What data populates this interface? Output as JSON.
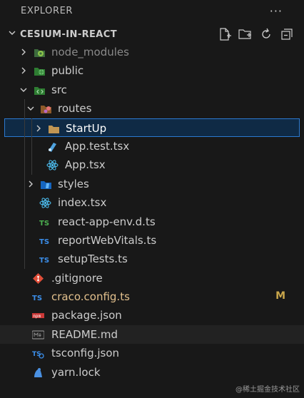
{
  "explorer": {
    "title": "EXPLORER",
    "more": "···"
  },
  "project": {
    "name": "CESIUM-IN-REACT"
  },
  "tree": [
    {
      "label": "node_modules",
      "depth": 0,
      "kind": "folder",
      "expanded": false,
      "icon": "node-modules-folder-icon",
      "color": "#8a8a8a"
    },
    {
      "label": "public",
      "depth": 0,
      "kind": "folder",
      "expanded": false,
      "icon": "public-folder-icon",
      "color": "#cccccc"
    },
    {
      "label": "src",
      "depth": 0,
      "kind": "folder",
      "expanded": true,
      "icon": "src-folder-icon",
      "color": "#cccccc"
    },
    {
      "label": "routes",
      "depth": 1,
      "kind": "folder",
      "expanded": true,
      "icon": "routes-folder-icon",
      "color": "#cccccc"
    },
    {
      "label": "StartUp",
      "depth": 2,
      "kind": "folder",
      "expanded": false,
      "icon": "folder-icon",
      "color": "#ffffff",
      "selected": true
    },
    {
      "label": "App.test.tsx",
      "depth": 2,
      "kind": "file",
      "icon": "test-react-icon",
      "color": "#cccccc"
    },
    {
      "label": "App.tsx",
      "depth": 2,
      "kind": "file",
      "icon": "react-icon",
      "color": "#cccccc"
    },
    {
      "label": "styles",
      "depth": 1,
      "kind": "folder",
      "expanded": false,
      "icon": "styles-folder-icon",
      "color": "#cccccc"
    },
    {
      "label": "index.tsx",
      "depth": 1,
      "kind": "file",
      "icon": "react-icon",
      "color": "#cccccc"
    },
    {
      "label": "react-app-env.d.ts",
      "depth": 1,
      "kind": "file",
      "icon": "ts-def-icon",
      "color": "#cccccc"
    },
    {
      "label": "reportWebVitals.ts",
      "depth": 1,
      "kind": "file",
      "icon": "typescript-icon",
      "color": "#cccccc"
    },
    {
      "label": "setupTests.ts",
      "depth": 1,
      "kind": "file",
      "icon": "typescript-icon",
      "color": "#cccccc"
    },
    {
      "label": ".gitignore",
      "depth": 0,
      "kind": "file",
      "icon": "git-icon",
      "color": "#cccccc"
    },
    {
      "label": "craco.config.ts",
      "depth": 0,
      "kind": "file",
      "icon": "typescript-icon",
      "color": "#e2c08d",
      "badge": "M"
    },
    {
      "label": "package.json",
      "depth": 0,
      "kind": "file",
      "icon": "npm-icon",
      "color": "#cccccc"
    },
    {
      "label": "README.md",
      "depth": 0,
      "kind": "file",
      "icon": "markdown-icon",
      "color": "#cccccc",
      "hover": true
    },
    {
      "label": "tsconfig.json",
      "depth": 0,
      "kind": "file",
      "icon": "tsconfig-icon",
      "color": "#cccccc"
    },
    {
      "label": "yarn.lock",
      "depth": 0,
      "kind": "file",
      "icon": "yarn-icon",
      "color": "#cccccc"
    }
  ],
  "watermark": "@稀土掘金技术社区"
}
